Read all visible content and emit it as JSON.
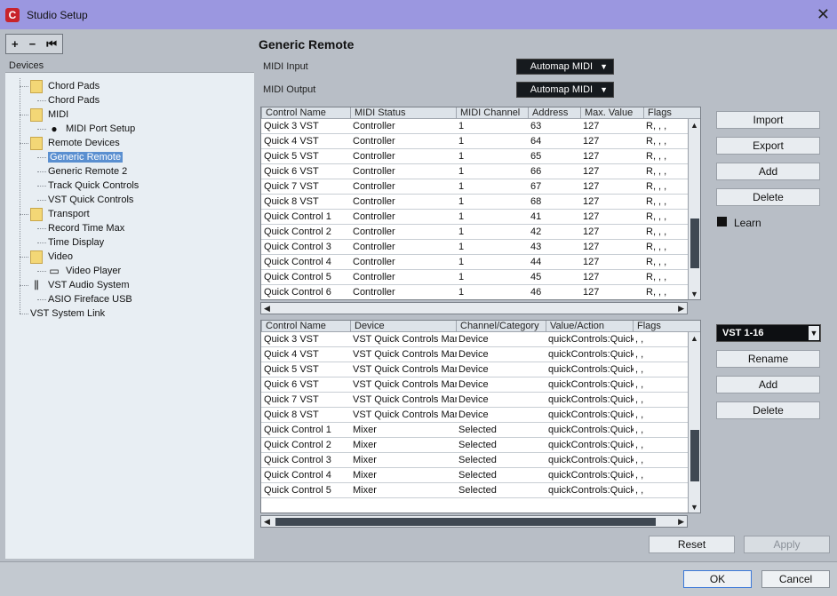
{
  "window": {
    "title": "Studio Setup"
  },
  "tree_toolbar": {
    "add": "+",
    "remove": "−",
    "reset": "⏮"
  },
  "devices_label": "Devices",
  "tree": [
    {
      "label": "Chord Pads",
      "kind": "folder"
    },
    {
      "label": "Chord Pads",
      "kind": "item"
    },
    {
      "label": "MIDI",
      "kind": "folder"
    },
    {
      "label": "MIDI Port Setup",
      "kind": "item"
    },
    {
      "label": "Remote Devices",
      "kind": "folder"
    },
    {
      "label": "Generic Remote",
      "kind": "item",
      "selected": true
    },
    {
      "label": "Generic Remote 2",
      "kind": "item"
    },
    {
      "label": "Track Quick Controls",
      "kind": "item"
    },
    {
      "label": "VST Quick Controls",
      "kind": "item"
    },
    {
      "label": "Transport",
      "kind": "folder"
    },
    {
      "label": "Record Time Max",
      "kind": "item"
    },
    {
      "label": "Time Display",
      "kind": "item"
    },
    {
      "label": "Video",
      "kind": "folder"
    },
    {
      "label": "Video Player",
      "kind": "item"
    },
    {
      "label": "VST Audio System",
      "kind": "item"
    },
    {
      "label": "ASIO Fireface USB",
      "kind": "item"
    },
    {
      "label": "VST System Link",
      "kind": "item"
    }
  ],
  "panel": {
    "title": "Generic Remote",
    "midi_input_label": "MIDI Input",
    "midi_input_value": "Automap MIDI",
    "midi_output_label": "MIDI Output",
    "midi_output_value": "Automap MIDI"
  },
  "table1": {
    "headers": [
      "Control Name",
      "MIDI Status",
      "MIDI Channel",
      "Address",
      "Max. Value",
      "Flags"
    ],
    "rows": [
      [
        "Quick 3 VST",
        "Controller",
        "1",
        "63",
        "127",
        "R, , ,"
      ],
      [
        "Quick 4 VST",
        "Controller",
        "1",
        "64",
        "127",
        "R, , ,"
      ],
      [
        "Quick 5 VST",
        "Controller",
        "1",
        "65",
        "127",
        "R, , ,"
      ],
      [
        "Quick 6 VST",
        "Controller",
        "1",
        "66",
        "127",
        "R, , ,"
      ],
      [
        "Quick 7 VST",
        "Controller",
        "1",
        "67",
        "127",
        "R, , ,"
      ],
      [
        "Quick 8 VST",
        "Controller",
        "1",
        "68",
        "127",
        "R, , ,"
      ],
      [
        "Quick Control 1",
        "Controller",
        "1",
        "41",
        "127",
        "R, , ,"
      ],
      [
        "Quick Control 2",
        "Controller",
        "1",
        "42",
        "127",
        "R, , ,"
      ],
      [
        "Quick Control 3",
        "Controller",
        "1",
        "43",
        "127",
        "R, , ,"
      ],
      [
        "Quick Control 4",
        "Controller",
        "1",
        "44",
        "127",
        "R, , ,"
      ],
      [
        "Quick Control 5",
        "Controller",
        "1",
        "45",
        "127",
        "R, , ,"
      ],
      [
        "Quick Control 6",
        "Controller",
        "1",
        "46",
        "127",
        "R, , ,"
      ]
    ]
  },
  "table2": {
    "headers": [
      "Control Name",
      "Device",
      "Channel/Category",
      "Value/Action",
      "Flags"
    ],
    "rows": [
      [
        "Quick 3 VST",
        "VST Quick Controls Mar",
        "Device",
        "quickControls:Quick",
        ", ,"
      ],
      [
        "Quick 4 VST",
        "VST Quick Controls Mar",
        "Device",
        "quickControls:Quick",
        ", ,"
      ],
      [
        "Quick 5 VST",
        "VST Quick Controls Mar",
        "Device",
        "quickControls:Quick",
        ", ,"
      ],
      [
        "Quick 6 VST",
        "VST Quick Controls Mar",
        "Device",
        "quickControls:Quick",
        ", ,"
      ],
      [
        "Quick 7 VST",
        "VST Quick Controls Mar",
        "Device",
        "quickControls:Quick",
        ", ,"
      ],
      [
        "Quick 8 VST",
        "VST Quick Controls Mar",
        "Device",
        "quickControls:Quick",
        ", ,"
      ],
      [
        "Quick Control 1",
        "Mixer",
        "Selected",
        "quickControls:Quick",
        ", ,"
      ],
      [
        "Quick Control 2",
        "Mixer",
        "Selected",
        "quickControls:Quick",
        ", ,"
      ],
      [
        "Quick Control 3",
        "Mixer",
        "Selected",
        "quickControls:Quick",
        ", ,"
      ],
      [
        "Quick Control 4",
        "Mixer",
        "Selected",
        "quickControls:Quick",
        ", ,"
      ],
      [
        "Quick Control 5",
        "Mixer",
        "Selected",
        "quickControls:Quick",
        ", ,"
      ]
    ]
  },
  "side_buttons": {
    "import": "Import",
    "export": "Export",
    "add": "Add",
    "delete": "Delete",
    "learn": "Learn",
    "bank_value": "VST 1-16",
    "rename": "Rename",
    "add2": "Add",
    "delete2": "Delete"
  },
  "bottom_buttons": {
    "reset": "Reset",
    "apply": "Apply"
  },
  "footer": {
    "ok": "OK",
    "cancel": "Cancel"
  }
}
